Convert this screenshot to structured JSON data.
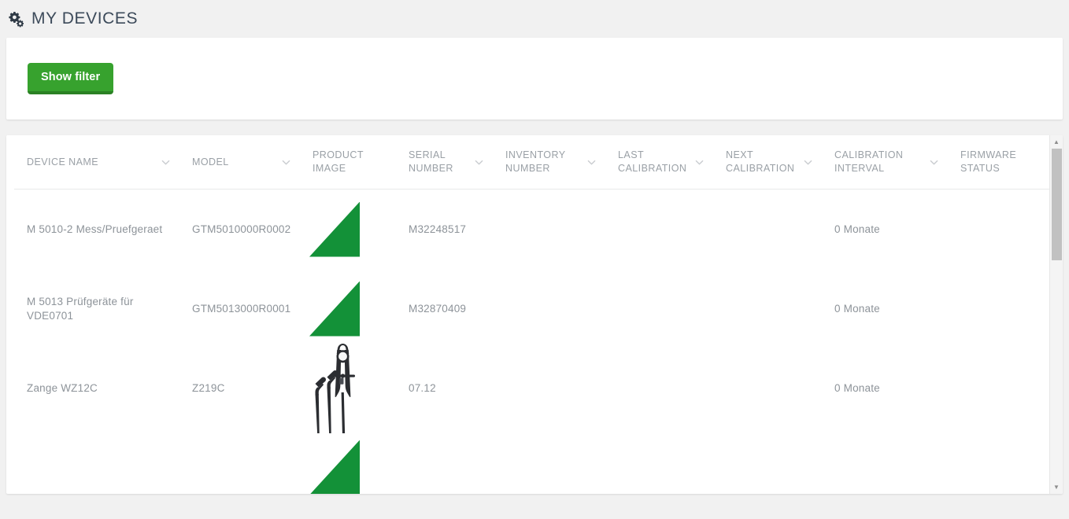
{
  "header": {
    "title": "MY DEVICES",
    "icon": "cogs-icon"
  },
  "filter_panel": {
    "show_filter_label": "Show filter"
  },
  "table": {
    "columns": [
      {
        "label": "DEVICE NAME",
        "sortable": true
      },
      {
        "label": "MODEL",
        "sortable": true
      },
      {
        "label": "PRODUCT IMAGE",
        "sortable": false
      },
      {
        "label": "SERIAL NUMBER",
        "sortable": true
      },
      {
        "label": "INVENTORY NUMBER",
        "sortable": true
      },
      {
        "label": "LAST CALIBRATION",
        "sortable": true
      },
      {
        "label": "NEXT CALIBRATION",
        "sortable": true
      },
      {
        "label": "CALIBRATION INTERVAL",
        "sortable": true
      },
      {
        "label": "FIRMWARE STATUS",
        "sortable": true
      }
    ],
    "rows": [
      {
        "device_name": "M 5010-2 Mess/Pruefgeraet",
        "model": "GTM5010000R0002",
        "product_image": "green-triangle-thumbnail",
        "serial_number": "M32248517",
        "inventory_number": "",
        "last_calibration": "",
        "next_calibration": "",
        "calibration_interval": "0 Monate",
        "firmware_status": ""
      },
      {
        "device_name": "M 5013 Prüfgeräte für VDE0701",
        "model": "GTM5013000R0001",
        "product_image": "green-triangle-thumbnail",
        "serial_number": "M32870409",
        "inventory_number": "",
        "last_calibration": "",
        "next_calibration": "",
        "calibration_interval": "0 Monate",
        "firmware_status": ""
      },
      {
        "device_name": "Zange WZ12C",
        "model": "Z219C",
        "product_image": "pliers-tool-thumbnail",
        "serial_number": "07.12",
        "inventory_number": "",
        "last_calibration": "",
        "next_calibration": "",
        "calibration_interval": "0 Monate",
        "firmware_status": ""
      },
      {
        "device_name": "",
        "model": "",
        "product_image": "green-triangle-thumbnail",
        "serial_number": "",
        "inventory_number": "",
        "last_calibration": "",
        "next_calibration": "",
        "calibration_interval": "",
        "firmware_status": ""
      }
    ],
    "scrollbar": {
      "up_arrow": "▲",
      "down_arrow": "▼"
    }
  },
  "colors": {
    "accent_green": "#37a22e",
    "accent_green_dark": "#2b8124",
    "thumbnail_green": "#139138",
    "page_background": "#f1f1f1",
    "card_background": "#ffffff",
    "header_text": "#3c4a5a",
    "muted_text": "#8d9399",
    "column_header_text": "#9aa0a6"
  }
}
